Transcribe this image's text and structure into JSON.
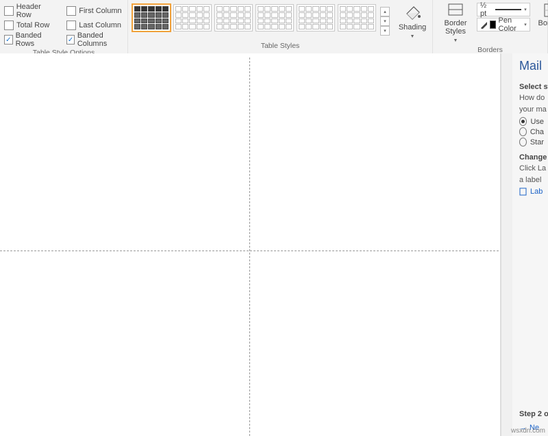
{
  "ribbon": {
    "styleOptions": {
      "label": "Table Style Options",
      "headerRow": "Header Row",
      "totalRow": "Total Row",
      "bandedRows": "Banded Rows",
      "firstColumn": "First Column",
      "lastColumn": "Last Column",
      "bandedColumns": "Banded Columns",
      "checked": {
        "headerRow": false,
        "totalRow": false,
        "bandedRows": true,
        "firstColumn": false,
        "lastColumn": false,
        "bandedColumns": true
      }
    },
    "tableStyles": {
      "label": "Table Styles"
    },
    "shading": {
      "label": "Shading"
    },
    "borderStyles": {
      "label": "Border Styles"
    },
    "borders": {
      "label": "Borders",
      "weight": "½ pt",
      "penColor": "Pen Color",
      "bordersBtn": "Borders"
    }
  },
  "panel": {
    "title": "Mail",
    "sect1": "Select st",
    "howdo": "How do",
    "yourma": "your ma",
    "optUse": "Use",
    "optCha": "Cha",
    "optStar": "Star",
    "sect2": "Change d",
    "clickLa": "Click La",
    "alabel": "a label",
    "lab": "Lab",
    "step": "Step 2 o",
    "next": "Ne"
  },
  "watermark": "wsxdn.com"
}
